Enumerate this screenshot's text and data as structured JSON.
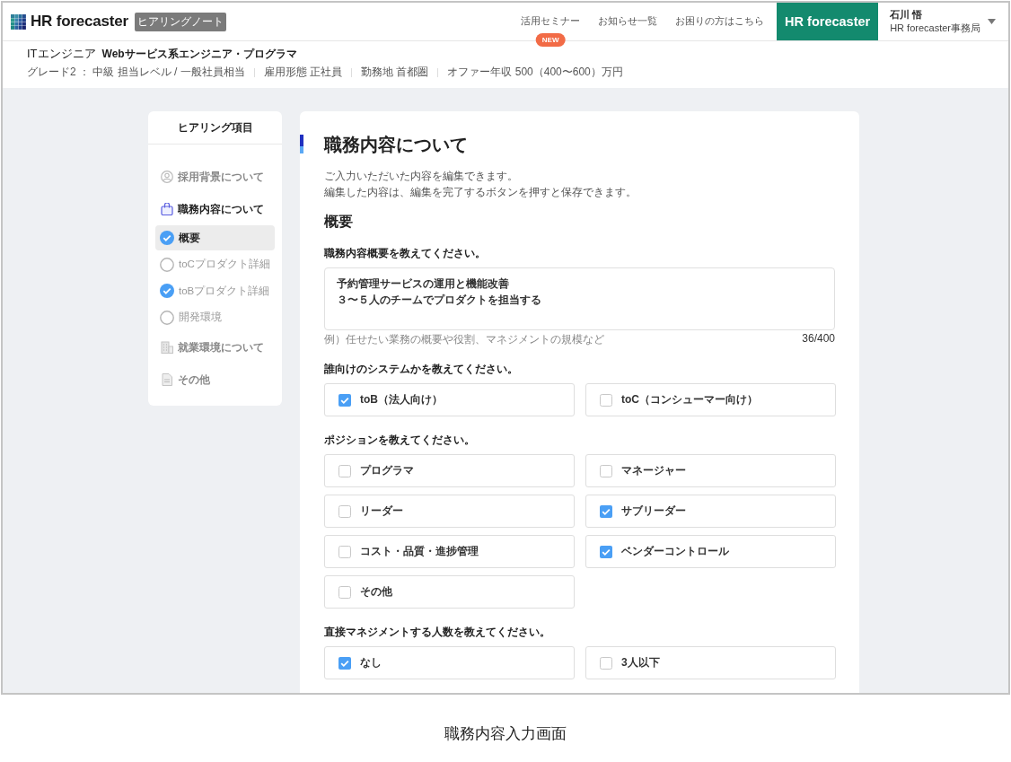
{
  "header": {
    "logo_text": "HR forecaster",
    "logo_badge": "ヒアリングノート",
    "nav": [
      {
        "label": "活用セミナー",
        "badge": "NEW"
      },
      {
        "label": "お知らせ一覧"
      },
      {
        "label": "お困りの方はこちら"
      }
    ],
    "brand_button": "HR forecaster",
    "user": {
      "name": "石川 悟",
      "org": "HR forecaster事務局"
    }
  },
  "job": {
    "title": "ITエンジニア",
    "category": "Webサービス系エンジニア・プログラマ",
    "details": [
      "グレード2 ： 中級 担当レベル / 一般社員相当",
      "雇用形態 正社員",
      "勤務地 首都圏",
      "オファー年収 500（400〜600）万円"
    ]
  },
  "sidebar": {
    "title": "ヒアリング項目",
    "sections": [
      {
        "label": "採用背景について",
        "kind": "person",
        "active": false
      },
      {
        "label": "職務内容について",
        "kind": "bag",
        "active": true,
        "children": [
          {
            "label": "概要",
            "checked": true,
            "selected": true
          },
          {
            "label": "toCプロダクト詳細",
            "checked": false,
            "selected": false
          },
          {
            "label": "toBプロダクト詳細",
            "checked": true,
            "selected": false
          },
          {
            "label": "開発環境",
            "checked": false,
            "selected": false
          }
        ]
      },
      {
        "label": "就業環境について",
        "kind": "building",
        "active": false
      },
      {
        "label": "その他",
        "kind": "document",
        "active": false
      }
    ]
  },
  "main": {
    "title": "職務内容について",
    "description": [
      "ご入力いただいた内容を編集できます。",
      "編集した内容は、編集を完了するボタンを押すと保存できます。"
    ],
    "section_title": "概要",
    "questions": [
      {
        "kind": "textarea",
        "label": "職務内容概要を教えてください。",
        "value": [
          "予約管理サービスの運用と機能改善",
          "３〜５人のチームでプロダクトを担当する"
        ],
        "hint": "例）任せたい業務の概要や役割、マネジメントの規模など",
        "counter": "36/400"
      },
      {
        "kind": "checkboxes",
        "label": "誰向けのシステムかを教えてください。",
        "options": [
          {
            "label": "toB（法人向け）",
            "checked": true
          },
          {
            "label": "toC（コンシューマー向け）",
            "checked": false
          }
        ]
      },
      {
        "kind": "checkboxes",
        "label": "ポジションを教えてください。",
        "options": [
          {
            "label": "プログラマ",
            "checked": false
          },
          {
            "label": "マネージャー",
            "checked": false
          },
          {
            "label": "リーダー",
            "checked": false
          },
          {
            "label": "サブリーダー",
            "checked": true
          },
          {
            "label": "コスト・品質・進捗管理",
            "checked": false
          },
          {
            "label": "ベンダーコントロール",
            "checked": true
          },
          {
            "label": "その他",
            "checked": false
          }
        ]
      },
      {
        "kind": "checkboxes",
        "label": "直接マネジメントする人数を教えてください。",
        "options": [
          {
            "label": "なし",
            "checked": true
          },
          {
            "label": "3人以下",
            "checked": false
          }
        ]
      }
    ]
  },
  "caption": "職務内容入力画面"
}
